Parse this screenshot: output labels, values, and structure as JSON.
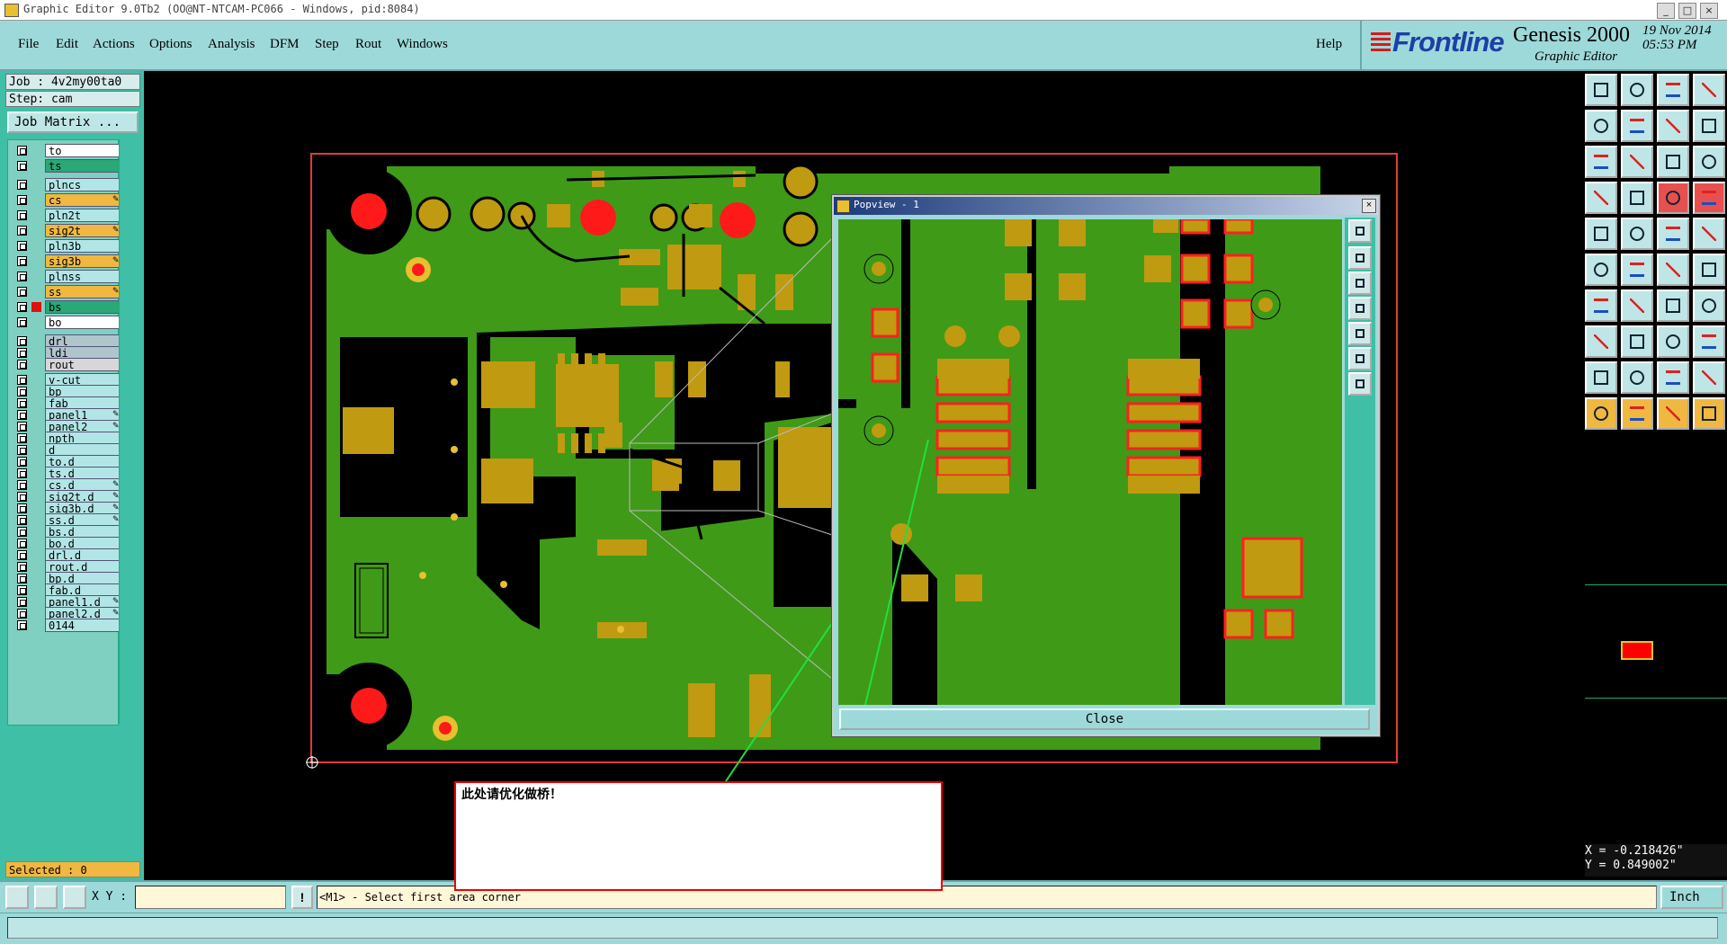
{
  "window": {
    "title": "Graphic Editor 9.0Tb2 (OO@NT-NTCAM-PC066 - Windows, pid:8084)",
    "controls": [
      "_",
      "□",
      "×"
    ]
  },
  "menubar": {
    "items": [
      "File",
      "Edit",
      "Actions",
      "Options",
      "Analysis",
      "DFM",
      "Step",
      "Rout",
      "Windows"
    ],
    "help": "Help"
  },
  "brand": {
    "company": "Frontline",
    "product": "Genesis 2000",
    "subtitle": "Graphic Editor",
    "date": "19 Nov 2014",
    "time": "05:53 PM"
  },
  "job": {
    "job_label": "Job : 4v2my00ta0",
    "step_label": "Step: cam",
    "matrix_button": "Job Matrix ..."
  },
  "layers": [
    {
      "name": "to",
      "color": "#ffffff"
    },
    {
      "name": "ts",
      "color": "#2aa876"
    },
    {
      "name": "plncs",
      "color": "#b2e6e6"
    },
    {
      "name": "cs",
      "color": "#f0b840",
      "mark": "✎"
    },
    {
      "name": "pln2t",
      "color": "#b2e6e6"
    },
    {
      "name": "sig2t",
      "color": "#f0b840",
      "mark": "✎"
    },
    {
      "name": "pln3b",
      "color": "#b2e6e6"
    },
    {
      "name": "sig3b",
      "color": "#f0b840",
      "mark": "✎"
    },
    {
      "name": "plnss",
      "color": "#b2e6e6"
    },
    {
      "name": "ss",
      "color": "#f0b840",
      "mark": "✎"
    },
    {
      "name": "bs",
      "color": "#2aa876",
      "active": true
    },
    {
      "name": "bo",
      "color": "#ffffff"
    },
    {
      "name": "drl",
      "color": "#b0c4cc"
    },
    {
      "name": "ldi",
      "color": "#b0c4cc"
    },
    {
      "name": "rout",
      "color": "#d7d7d7"
    },
    {
      "name": "v-cut",
      "color": "#b2e6e6"
    },
    {
      "name": "bp",
      "color": "#b2e6e6"
    },
    {
      "name": "fab",
      "color": "#b2e6e6"
    },
    {
      "name": "panel1",
      "color": "#b2e6e6",
      "mark": "✎"
    },
    {
      "name": "panel2",
      "color": "#b2e6e6",
      "mark": "✎"
    },
    {
      "name": "npth",
      "color": "#b2e6e6"
    },
    {
      "name": "d",
      "color": "#b2e6e6"
    },
    {
      "name": "to.d",
      "color": "#b2e6e6"
    },
    {
      "name": "ts.d",
      "color": "#b2e6e6"
    },
    {
      "name": "cs.d",
      "color": "#b2e6e6",
      "mark": "✎"
    },
    {
      "name": "sig2t.d",
      "color": "#b2e6e6",
      "mark": "✎"
    },
    {
      "name": "sig3b.d",
      "color": "#b2e6e6",
      "mark": "✎"
    },
    {
      "name": "ss.d",
      "color": "#b2e6e6",
      "mark": "✎"
    },
    {
      "name": "bs.d",
      "color": "#b2e6e6"
    },
    {
      "name": "bo.d",
      "color": "#b2e6e6"
    },
    {
      "name": "drl.d",
      "color": "#b2e6e6"
    },
    {
      "name": "rout.d",
      "color": "#b2e6e6"
    },
    {
      "name": "bp.d",
      "color": "#b2e6e6"
    },
    {
      "name": "fab.d",
      "color": "#b2e6e6"
    },
    {
      "name": "panel1.d",
      "color": "#b2e6e6",
      "mark": "✎"
    },
    {
      "name": "panel2.d",
      "color": "#b2e6e6",
      "mark": "✎"
    },
    {
      "name": "0144",
      "color": "#b2e6e6"
    }
  ],
  "selected": "Selected : 0",
  "popview": {
    "title": "Popview - 1",
    "close_button": "Close"
  },
  "note": {
    "text": "此处请优化做桥！"
  },
  "coordinates": {
    "x": "X = -0.218426\"",
    "y": "Y = 0.849002\""
  },
  "bottombar": {
    "xy_label": "X Y :",
    "xy_value": "",
    "warn": "!",
    "prompt": "<M1> - Select first area corner",
    "units": "Inch"
  },
  "colors": {
    "ui_bg": "#9ed9d9",
    "board_green": "#3f9a18",
    "copper": "#c09a10",
    "drill_red": "#ff1a1a",
    "outline_red": "#e03c3c",
    "arrow_green": "#20e040"
  }
}
